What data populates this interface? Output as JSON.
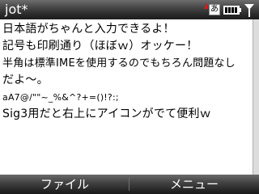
{
  "app": {
    "title": "jot*"
  },
  "status_bar": {
    "ime_indicator": "あ",
    "icons": [
      "ime-indicator-icon",
      "battery-icon",
      "signal-strength-icon"
    ]
  },
  "document": {
    "lines": [
      "日本語がちゃんと入力できるよ！",
      "記号も印刷通り（ほぼｗ）オッケー！",
      "半角は標準IMEを使用するのでもちろん問題なし",
      "だよ～。",
      "aA7@/\"\"~_%&^?+=()!?:;",
      "Sig3用だと右上にアイコンがでて便利ｗ"
    ]
  },
  "soft_keys": {
    "left_label": "ファイル",
    "right_label": "メニュー"
  },
  "colors": {
    "bar_dark": "#1c1c1c",
    "bar_light": "#6d6d6d",
    "text": "#000000",
    "background": "#ffffff",
    "accent_red": "#d81818"
  }
}
